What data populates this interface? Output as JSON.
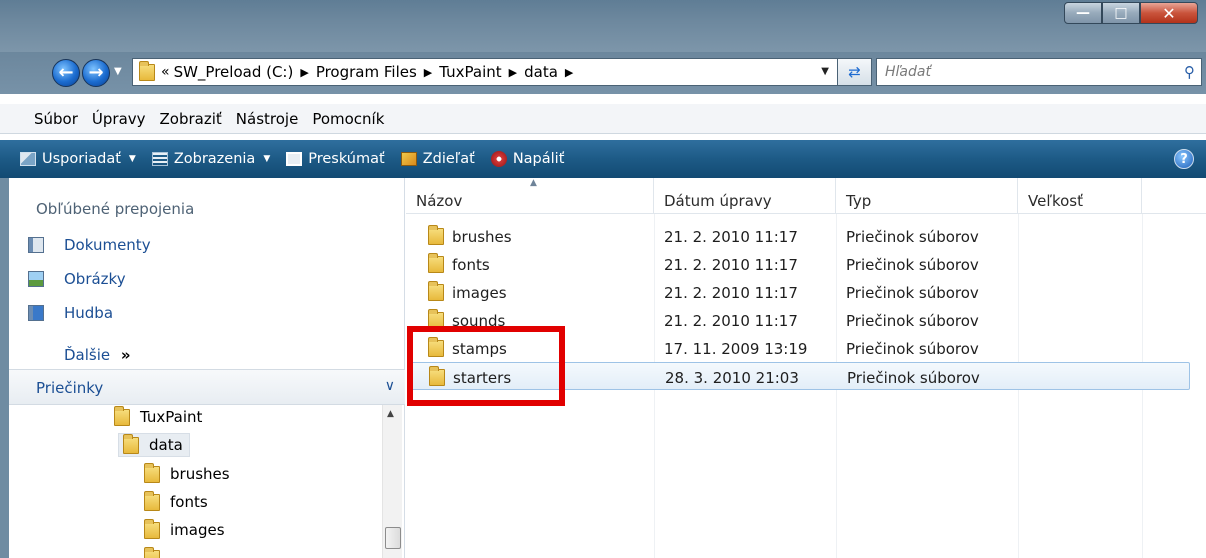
{
  "address": {
    "overflow": "«",
    "crumbs": [
      "SW_Preload (C:)",
      "Program Files",
      "TuxPaint",
      "data"
    ]
  },
  "search": {
    "placeholder": "Hľadať"
  },
  "menu": [
    "Súbor",
    "Úpravy",
    "Zobraziť",
    "Nástroje",
    "Pomocník"
  ],
  "toolbar": {
    "organize": "Usporiadať",
    "views": "Zobrazenia",
    "explore": "Preskúmať",
    "share": "Zdieľať",
    "burn": "Napáliť"
  },
  "nav": {
    "favorites_title": "Obľúbené prepojenia",
    "favorites": [
      "Dokumenty",
      "Obrázky",
      "Hudba"
    ],
    "more": "Ďalšie",
    "more_glyph": "»",
    "folders_title": "Priečinky",
    "tree": [
      "TuxPaint",
      "data",
      "brushes",
      "fonts",
      "images"
    ]
  },
  "columns": {
    "name": "Názov",
    "modified": "Dátum úpravy",
    "type": "Typ",
    "size": "Veľkosť"
  },
  "files": [
    {
      "name": "brushes",
      "modified": "21. 2. 2010 11:17",
      "type": "Priečinok súborov"
    },
    {
      "name": "fonts",
      "modified": "21. 2. 2010 11:17",
      "type": "Priečinok súborov"
    },
    {
      "name": "images",
      "modified": "21. 2. 2010 11:17",
      "type": "Priečinok súborov"
    },
    {
      "name": "sounds",
      "modified": "21. 2. 2010 11:17",
      "type": "Priečinok súborov"
    },
    {
      "name": "stamps",
      "modified": "17. 11. 2009 13:19",
      "type": "Priečinok súborov"
    },
    {
      "name": "starters",
      "modified": "28. 3. 2010 21:03",
      "type": "Priečinok súborov"
    }
  ],
  "colors": {
    "highlight": "#e10000",
    "toolbar": "#1d5a86",
    "link": "#1c4f94"
  }
}
